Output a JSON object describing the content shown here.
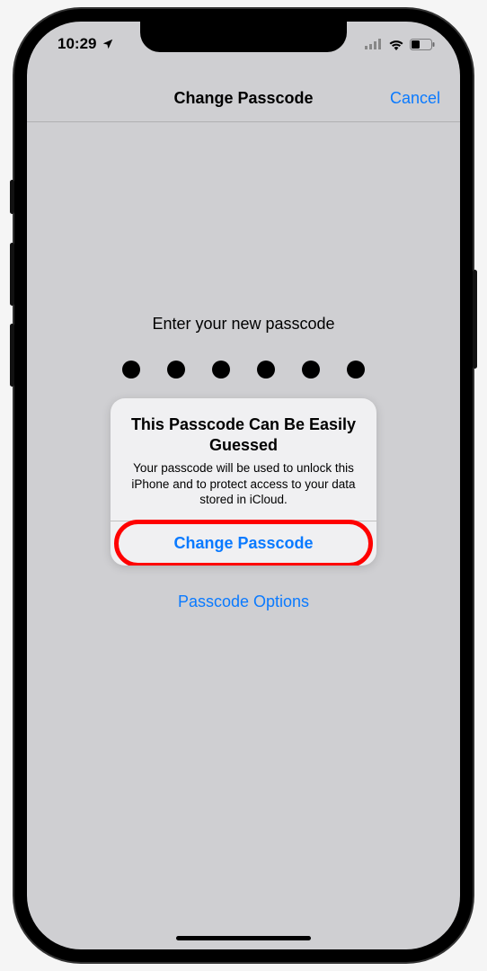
{
  "status": {
    "time": "10:29"
  },
  "nav": {
    "title": "Change Passcode",
    "cancel": "Cancel"
  },
  "prompt": "Enter your new passcode",
  "passcode": {
    "length": 6,
    "filled": 6
  },
  "alert": {
    "title": "This Passcode Can Be Easily Guessed",
    "message": "Your passcode will be used to unlock this iPhone and to protect access to your data stored in iCloud.",
    "button": "Change Passcode"
  },
  "options_link": "Passcode Options",
  "colors": {
    "accent": "#0a7aff",
    "highlight": "#ff0000",
    "background": "#cfcfd2"
  }
}
